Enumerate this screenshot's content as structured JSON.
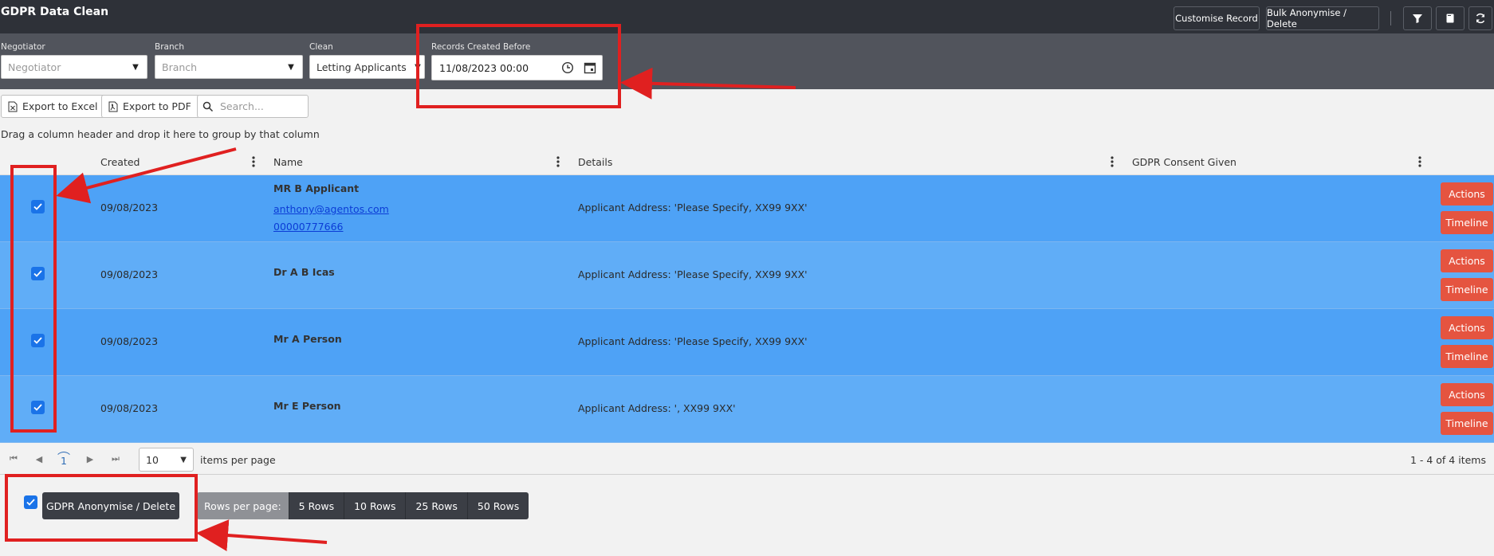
{
  "app": {
    "title": "GDPR Data Clean"
  },
  "topbar": {
    "customise_label": "Customise Record",
    "bulk_label": "Bulk Anonymise / Delete",
    "icons": [
      "filter-icon",
      "document-icon",
      "refresh-icon"
    ]
  },
  "filters": {
    "negotiator": {
      "label": "Negotiator",
      "placeholder": "Negotiator"
    },
    "branch": {
      "label": "Branch",
      "placeholder": "Branch"
    },
    "clean": {
      "label": "Clean",
      "value": "Letting Applicants"
    },
    "records_before": {
      "label": "Records Created Before",
      "value": "11/08/2023 00:00"
    }
  },
  "toolbar": {
    "export_excel": "Export to Excel",
    "export_pdf": "Export to PDF",
    "search_placeholder": "Search..."
  },
  "grid": {
    "group_hint": "Drag a column header and drop it here to group by that column",
    "columns": [
      "Created",
      "Name",
      "Details",
      "GDPR Consent Given"
    ],
    "actions_label": "Actions",
    "timeline_label": "Timeline",
    "rows": [
      {
        "created": "09/08/2023",
        "name": "MR B Applicant",
        "email": "anthony@agentos.com",
        "phone": "00000777666",
        "details": "Applicant Address: 'Please Specify, XX99 9XX'",
        "checked": true
      },
      {
        "created": "09/08/2023",
        "name": "Dr A B Icas",
        "details": "Applicant Address: 'Please Specify, XX99 9XX'",
        "checked": true
      },
      {
        "created": "09/08/2023",
        "name": "Mr A Person",
        "details": "Applicant Address: 'Please Specify, XX99 9XX'",
        "checked": true
      },
      {
        "created": "09/08/2023",
        "name": "Mr E Person",
        "details": "Applicant Address: ', XX99 9XX'",
        "checked": true
      }
    ]
  },
  "pager": {
    "current_page": "1",
    "page_size": "10",
    "items_per_page_label": "items per page",
    "summary": "1 - 4 of 4 items"
  },
  "footer": {
    "gdpr_button": "GDPR Anonymise / Delete",
    "rows_per_page_label": "Rows per page:",
    "rows_options": [
      "5 Rows",
      "10 Rows",
      "25 Rows",
      "50 Rows"
    ]
  },
  "colors": {
    "selected_row": "#4ea2f6",
    "action_red": "#e55440",
    "annotation_red": "#e02020"
  }
}
